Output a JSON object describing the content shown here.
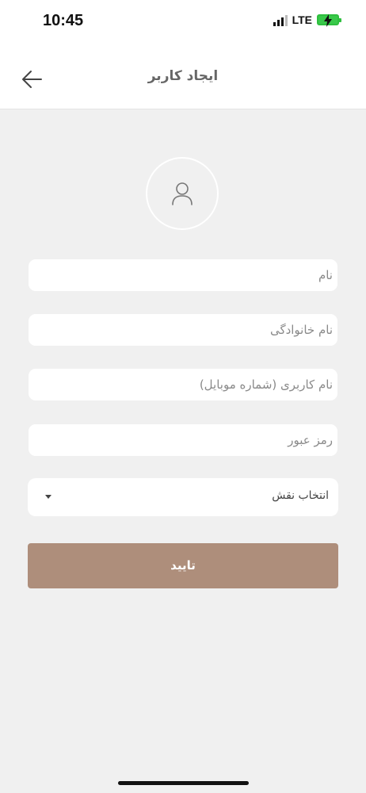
{
  "status_bar": {
    "time": "10:45",
    "network": "LTE"
  },
  "header": {
    "title": "ایجاد کاربر",
    "back_icon": "arrow-left-icon"
  },
  "avatar": {
    "icon": "user-icon"
  },
  "form": {
    "first_name_placeholder": "نام",
    "last_name_placeholder": "نام خانوادگی",
    "username_placeholder": "نام کاربری (شماره موبایل)",
    "password_placeholder": "رمز عبور",
    "role_select": {
      "selected": "انتخاب نقش",
      "caret_icon": "caret-down-icon"
    },
    "submit_label": "تایید"
  },
  "colors": {
    "background": "#f0f0f0",
    "header_bg": "#ffffff",
    "primary_button": "#ae8e7b",
    "battery": "#39c94a"
  }
}
